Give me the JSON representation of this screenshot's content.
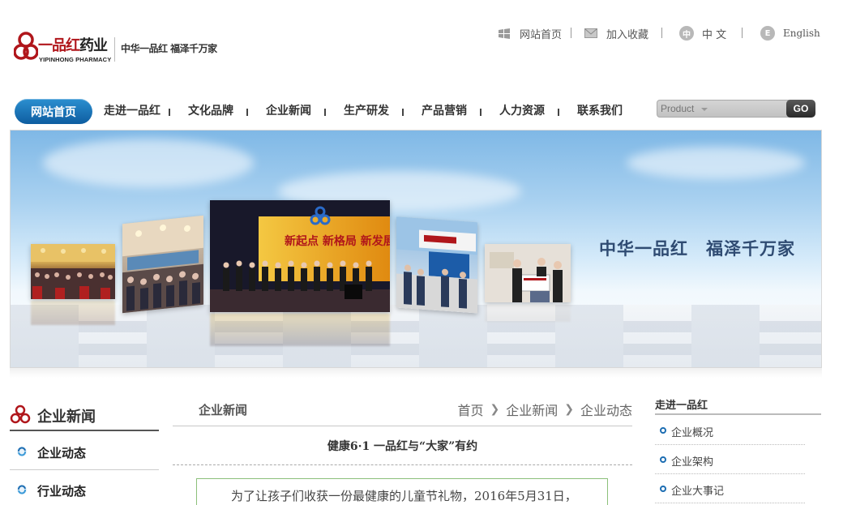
{
  "brand": {
    "logo_cn_red": "一品红",
    "logo_cn_dark": "药业",
    "logo_en": "YIPINHONG PHARMACY",
    "slogan": "中华一品红 福泽千万家"
  },
  "toplinks": {
    "home": "网站首页",
    "favorite": "加入收藏",
    "cn_badge": "中",
    "cn": "中 文",
    "en_badge": "E",
    "en": "English"
  },
  "nav": {
    "home": "网站首页",
    "items": [
      "走进一品红",
      "文化品牌",
      "企业新闻",
      "生产研发",
      "产品营销",
      "人力资源",
      "联系我们"
    ]
  },
  "search": {
    "placeholder": "Product",
    "go": "GO"
  },
  "banner": {
    "slogan": "中华一品红　福泽千万家",
    "stage_text": "新起点 新格局 新发展"
  },
  "left_sidebar": {
    "title": "企业新闻",
    "items": [
      "企业动态",
      "行业动态"
    ]
  },
  "main": {
    "title": "企业新闻",
    "breadcrumb": [
      "首页",
      "企业新闻",
      "企业动态"
    ],
    "article_title": "健康6·1 一品红与“大家”有约",
    "article_text": "为了让孩子们收获一份最健康的儿童节礼物，2016年5月31日，"
  },
  "right_sidebar": {
    "title": "走进一品红",
    "items": [
      "企业概况",
      "企业架构",
      "企业大事记"
    ]
  },
  "colors": {
    "brand_red": "#b0161b",
    "nav_blue": "#0e5da0",
    "link_blue": "#1c6db2"
  }
}
